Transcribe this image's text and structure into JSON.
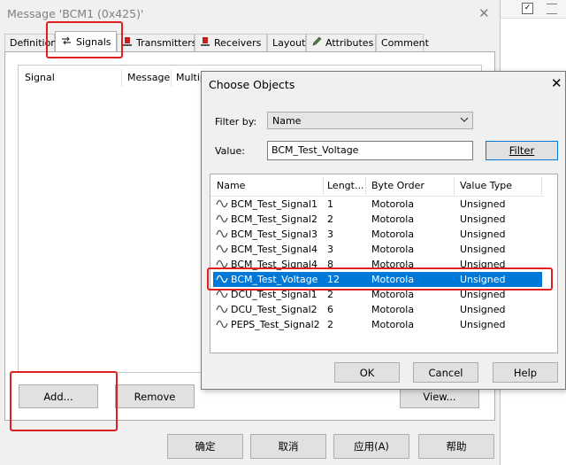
{
  "parent_window": {
    "title": "Message 'BCM1 (0x425)'",
    "tabs": [
      {
        "label": "Definition",
        "icon": ""
      },
      {
        "label": "Signals",
        "icon": "signal-arrows-icon"
      },
      {
        "label": "Transmitters",
        "icon": "node-icon"
      },
      {
        "label": "Receivers",
        "icon": "node-icon"
      },
      {
        "label": "Layout",
        "icon": ""
      },
      {
        "label": "Attributes",
        "icon": "pencil-icon"
      },
      {
        "label": "Comment",
        "icon": ""
      }
    ],
    "columns": [
      "Signal",
      "Message",
      "Multip"
    ],
    "add_label": "Add...",
    "remove_label": "Remove",
    "view_label": "View...",
    "ok_label": "确定",
    "cancel_label": "取消",
    "apply_label": "应用(A)",
    "help_label": "帮助"
  },
  "dialog": {
    "title": "Choose Objects",
    "filter_by_label": "Filter by:",
    "filter_by_value": "Name",
    "value_label": "Value:",
    "value_text": "BCM_Test_Voltage",
    "filter_button": "Filter",
    "columns": [
      "Name",
      "Lengt...",
      "Byte Order",
      "Value Type"
    ],
    "rows": [
      {
        "name": "BCM_Test_Signal1",
        "length": "1",
        "byte_order": "Motorola",
        "value_type": "Unsigned"
      },
      {
        "name": "BCM_Test_Signal2",
        "length": "2",
        "byte_order": "Motorola",
        "value_type": "Unsigned"
      },
      {
        "name": "BCM_Test_Signal3",
        "length": "3",
        "byte_order": "Motorola",
        "value_type": "Unsigned"
      },
      {
        "name": "BCM_Test_Signal4",
        "length": "3",
        "byte_order": "Motorola",
        "value_type": "Unsigned"
      },
      {
        "name": "BCM_Test_Signal4",
        "length": "8",
        "byte_order": "Motorola",
        "value_type": "Unsigned"
      },
      {
        "name": "BCM_Test_Voltage",
        "length": "12",
        "byte_order": "Motorola",
        "value_type": "Unsigned",
        "selected": true
      },
      {
        "name": "DCU_Test_Signal1",
        "length": "2",
        "byte_order": "Motorola",
        "value_type": "Unsigned"
      },
      {
        "name": "DCU_Test_Signal2",
        "length": "6",
        "byte_order": "Motorola",
        "value_type": "Unsigned"
      },
      {
        "name": "PEPS_Test_Signal2",
        "length": "2",
        "byte_order": "Motorola",
        "value_type": "Unsigned"
      }
    ],
    "ok_label": "OK",
    "cancel_label": "Cancel",
    "help_label": "Help"
  },
  "colors": {
    "highlight": "#e02020",
    "selection": "#0078d7"
  }
}
